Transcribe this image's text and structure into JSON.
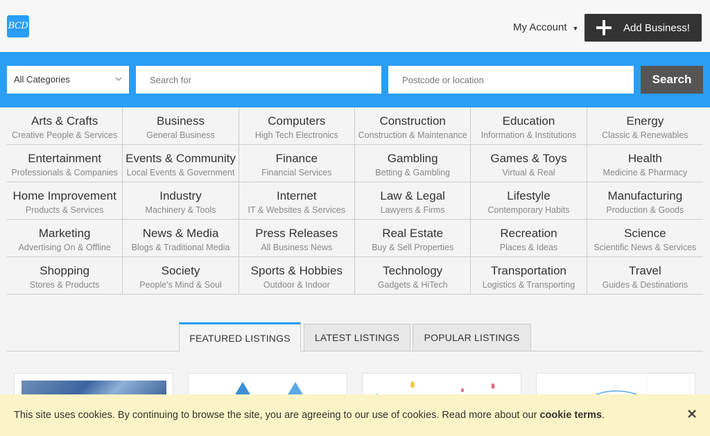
{
  "header": {
    "logo_text": "BCD",
    "account_label": "My Account",
    "add_business_label": "Add Business!"
  },
  "search": {
    "category_selected": "All Categories",
    "query_placeholder": "Search for",
    "location_placeholder": "Postcode or location",
    "button_label": "Search"
  },
  "categories": [
    {
      "title": "Arts & Crafts",
      "subtitle": "Creative People & Services"
    },
    {
      "title": "Business",
      "subtitle": "General Business"
    },
    {
      "title": "Computers",
      "subtitle": "High Tech Electronics"
    },
    {
      "title": "Construction",
      "subtitle": "Construction & Maintenance"
    },
    {
      "title": "Education",
      "subtitle": "Information & Institutions"
    },
    {
      "title": "Energy",
      "subtitle": "Classic & Renewables"
    },
    {
      "title": "Entertainment",
      "subtitle": "Professionals & Companies"
    },
    {
      "title": "Events & Community",
      "subtitle": "Local Events & Government"
    },
    {
      "title": "Finance",
      "subtitle": "Financial Services"
    },
    {
      "title": "Gambling",
      "subtitle": "Betting & Gambling"
    },
    {
      "title": "Games & Toys",
      "subtitle": "Virtual & Real"
    },
    {
      "title": "Health",
      "subtitle": "Medicine & Pharmacy"
    },
    {
      "title": "Home Improvement",
      "subtitle": "Products & Services"
    },
    {
      "title": "Industry",
      "subtitle": "Machinery & Tools"
    },
    {
      "title": "Internet",
      "subtitle": "IT & Websites & Services"
    },
    {
      "title": "Law & Legal",
      "subtitle": "Lawyers & Firms"
    },
    {
      "title": "Lifestyle",
      "subtitle": "Contemporary Habits"
    },
    {
      "title": "Manufacturing",
      "subtitle": "Production & Goods"
    },
    {
      "title": "Marketing",
      "subtitle": "Advertising On & Offline"
    },
    {
      "title": "News & Media",
      "subtitle": "Blogs & Traditional Media"
    },
    {
      "title": "Press Releases",
      "subtitle": "All Business News"
    },
    {
      "title": "Real Estate",
      "subtitle": "Buy & Sell Properties"
    },
    {
      "title": "Recreation",
      "subtitle": "Places & Ideas"
    },
    {
      "title": "Science",
      "subtitle": "Scientific News & Services"
    },
    {
      "title": "Shopping",
      "subtitle": "Stores & Products"
    },
    {
      "title": "Society",
      "subtitle": "People's Mind & Soul"
    },
    {
      "title": "Sports & Hobbies",
      "subtitle": "Outdoor & Indoor"
    },
    {
      "title": "Technology",
      "subtitle": "Gadgets & HiTech"
    },
    {
      "title": "Transportation",
      "subtitle": "Logistics & Transporting"
    },
    {
      "title": "Travel",
      "subtitle": "Guides & Destinations"
    }
  ],
  "tabs": [
    {
      "label": "FEATURED LISTINGS"
    },
    {
      "label": "LATEST LISTINGS"
    },
    {
      "label": "POPULAR LISTINGS"
    }
  ],
  "cookie": {
    "text": "This site uses cookies. By continuing to browse the site, you are agreeing to our use of cookies. Read more about our ",
    "link": "cookie terms",
    "end": "."
  },
  "colors": {
    "accent": "#2a9df4",
    "dark_button": "#333333",
    "search_button": "#555555",
    "cookie_bg": "#fcf4c6"
  },
  "icons": {
    "add": "plus-icon",
    "account": "caret-down-icon",
    "select": "chevron-down-icon",
    "cookie_close": "close-icon"
  }
}
